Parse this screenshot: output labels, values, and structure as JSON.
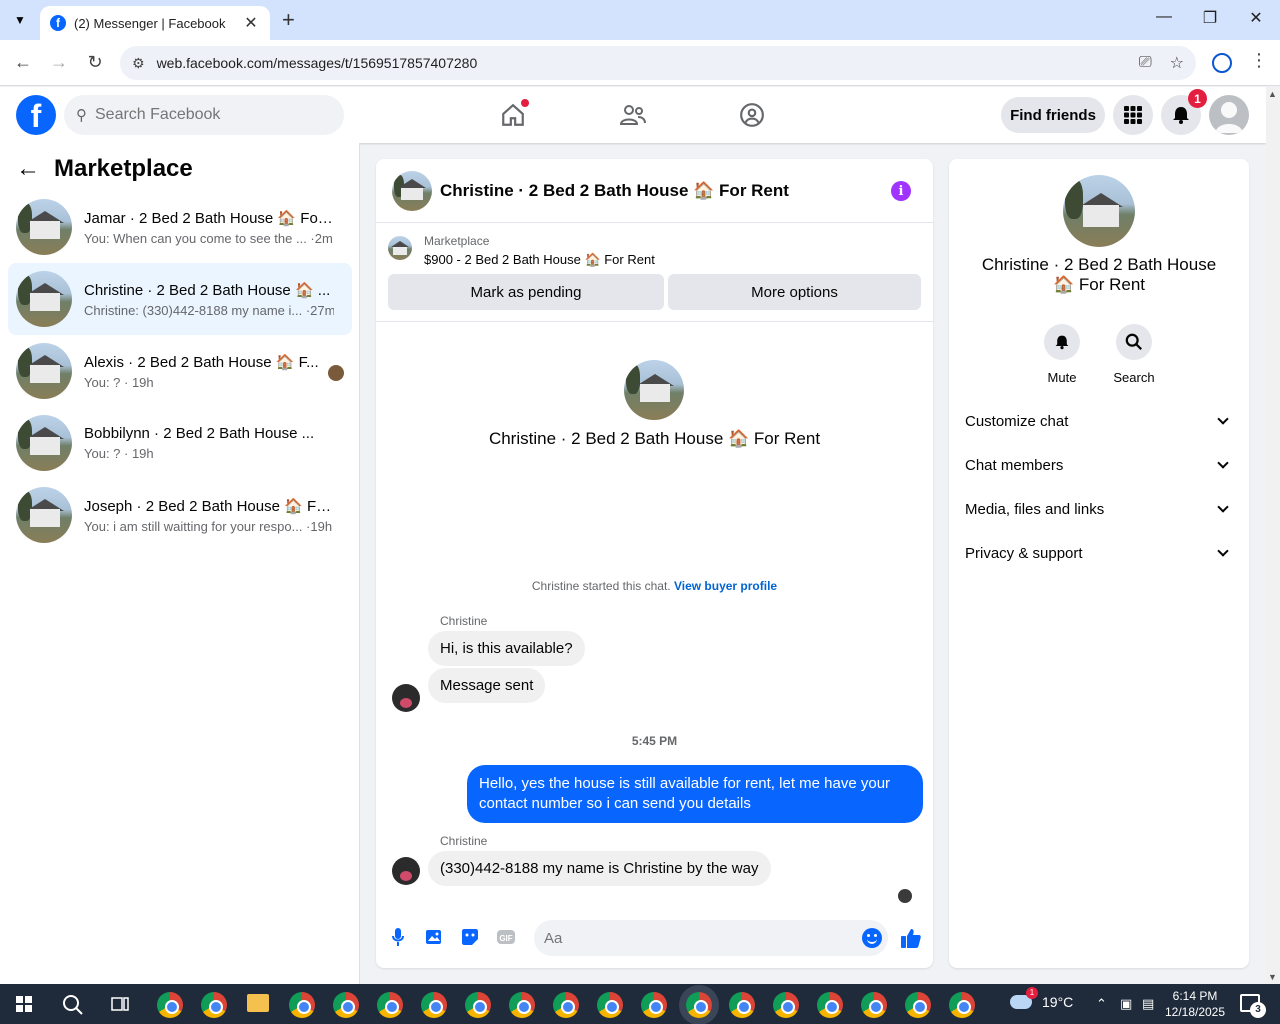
{
  "browser": {
    "tab_title": "(2) Messenger | Facebook",
    "url": "web.facebook.com/messages/t/1569517857407280"
  },
  "fb_header": {
    "search_placeholder": "Search Facebook",
    "find_friends_label": "Find friends",
    "notification_count": "1"
  },
  "left_panel": {
    "title": "Marketplace",
    "conversations": [
      {
        "name": "Jamar · 2 Bed 2 Bath House 🏠 For...",
        "preview": "You: When can you come to see the ... ·2m",
        "active": false
      },
      {
        "name": "Christine · 2 Bed 2 Bath House 🏠 ...",
        "preview": "Christine: (330)442-8188 my name i... ·27m",
        "active": true
      },
      {
        "name": "Alexis · 2 Bed 2 Bath House 🏠 F...",
        "preview": "You: ? · 19h",
        "active": false
      },
      {
        "name": "Bobbilynn · 2 Bed 2 Bath House ...",
        "preview": "You: ? · 19h",
        "active": false
      },
      {
        "name": "Joseph · 2 Bed 2 Bath House 🏠 Fo...",
        "preview": "You: i am still waitting for your respo... ·19h",
        "active": false
      }
    ]
  },
  "chat": {
    "title": "Christine · 2 Bed 2 Bath House 🏠 For Rent",
    "marketplace_label": "Marketplace",
    "listing": "$900 - 2 Bed 2 Bath House 🏠 For Rent",
    "mark_pending_label": "Mark as pending",
    "more_options_label": "More options",
    "intro_name": "Christine · 2 Bed 2 Bath House 🏠 For Rent",
    "system_text": "Christine started this chat. ",
    "system_link": "View buyer profile",
    "sender_name": "Christine",
    "msg_1": "Hi, is this available?",
    "msg_2": "Message sent",
    "timestamp": "5:45 PM",
    "msg_out": "Hello, yes the house is still available for rent, let me have your contact number so i can send you  details",
    "sender_name_2": "Christine",
    "msg_3": "(330)442-8188 my name is Christine by the way",
    "composer_placeholder": "Aa"
  },
  "right_panel": {
    "name": "Christine · 2 Bed 2 Bath House 🏠 For Rent",
    "mute_label": "Mute",
    "search_label": "Search",
    "rows": [
      "Customize chat",
      "Chat members",
      "Media, files and links",
      "Privacy & support"
    ]
  },
  "taskbar": {
    "temperature": "19°C",
    "time": "6:14 PM",
    "date": "12/18/2025",
    "notification_count": "3",
    "weather_badge": "1"
  }
}
